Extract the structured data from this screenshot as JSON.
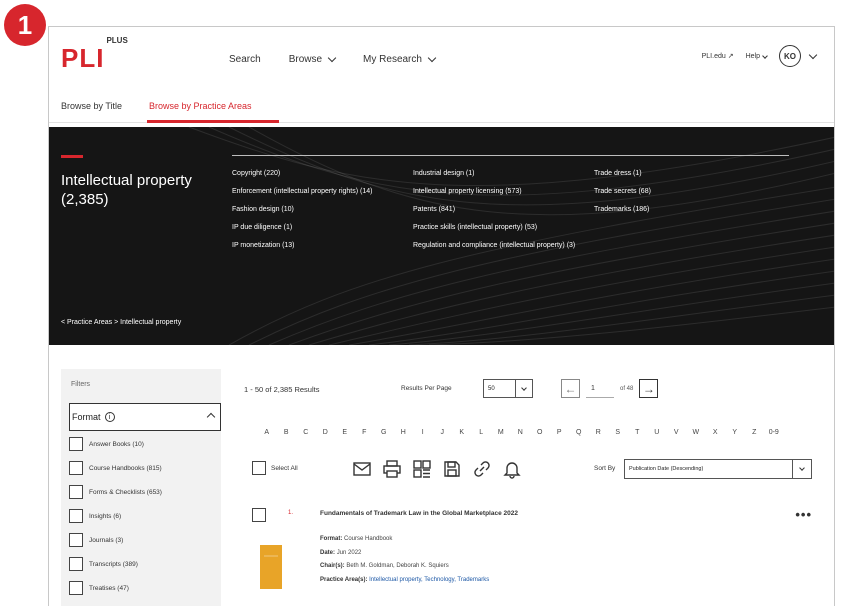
{
  "step_badge": "1",
  "logo": {
    "text": "PLI",
    "sup": "PLUS"
  },
  "nav": {
    "search": "Search",
    "browse": "Browse",
    "my_research": "My Research"
  },
  "right_nav": {
    "pli_edu": "PLI.edu",
    "ext_icon": "↗",
    "help": "Help",
    "avatar": "KO"
  },
  "tabs": {
    "by_title": "Browse by Title",
    "by_practice": "Browse by Practice Areas"
  },
  "hero": {
    "title": "Intellectual property",
    "count": "(2,385)",
    "col1": [
      "Copyright (220)",
      "Enforcement (intellectual property rights) (14)",
      "Fashion design (10)",
      "IP due diligence (1)",
      "IP monetization (13)"
    ],
    "col2": [
      "Industrial design (1)",
      "Intellectual property licensing (573)",
      "Patents (841)",
      "Practice skills (intellectual property) (53)",
      "Regulation and compliance (intellectual property) (3)"
    ],
    "col3": [
      "Trade dress (1)",
      "Trade secrets (68)",
      "Trademarks (186)"
    ],
    "breadcrumb": "< Practice Areas > Intellectual property"
  },
  "filters": {
    "label": "Filters",
    "format_label": "Format",
    "info_icon": "i",
    "items": [
      "Answer Books (10)",
      "Course Handbooks (815)",
      "Forms & Checklists (653)",
      "Insights (6)",
      "Journals (3)",
      "Transcripts (389)",
      "Treatises (47)"
    ]
  },
  "results": {
    "count_text": "1 - 50 of 2,385 Results",
    "rpp_label": "Results Per Page",
    "rpp_value": "50",
    "page_value": "1",
    "page_of": "of 48",
    "prev_arrow": "←",
    "next_arrow": "→",
    "alphabet": [
      "A",
      "B",
      "C",
      "D",
      "E",
      "F",
      "G",
      "H",
      "I",
      "J",
      "K",
      "L",
      "M",
      "N",
      "O",
      "P",
      "Q",
      "R",
      "S",
      "T",
      "U",
      "V",
      "W",
      "X",
      "Y",
      "Z",
      "0-9"
    ],
    "select_all": "Select All",
    "sort_label": "Sort By",
    "sort_value": "Publication Date (Descending)"
  },
  "result_item": {
    "number": "1.",
    "title": "Fundamentals of Trademark Law in the Global Marketplace 2022",
    "format_label": "Format:",
    "format_value": "Course Handbook",
    "date_label": "Date:",
    "date_value": "Jun 2022",
    "chairs_label": "Chair(s):",
    "chairs_value": "Beth M. Goldman, Deborah K. Squiers",
    "practice_label": "Practice Area(s):",
    "practice_value": "Intellectual property, Technology, Trademarks",
    "more": "•••"
  },
  "colors": {
    "brand_red": "#d7262d",
    "hero_bg": "#151515",
    "book": "#e8a428",
    "link": "#1d58a6"
  }
}
